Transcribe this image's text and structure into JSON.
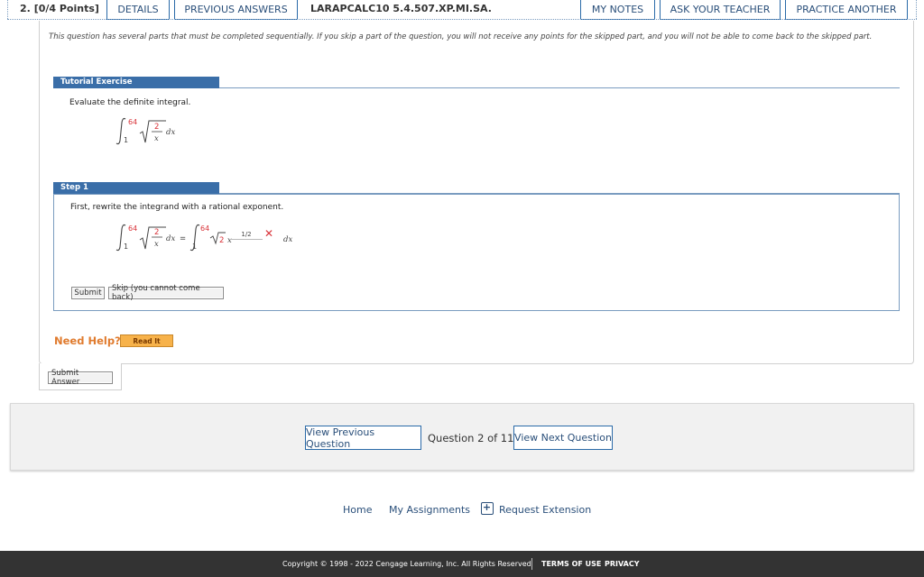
{
  "header": {
    "question_number": "2.",
    "points": "[0/4 Points]",
    "tabs": [
      "DETAILS",
      "PREVIOUS ANSWERS"
    ],
    "question_code": "LARAPCALC10 5.4.507.XP.MI.SA.",
    "actions": [
      "MY NOTES",
      "ASK YOUR TEACHER",
      "PRACTICE ANOTHER"
    ]
  },
  "instructions": "This question has several parts that must be completed sequentially. If you skip a part of the question, you will not receive any points for the skipped part, and you will not be able to come back to the skipped part.",
  "tutorial": {
    "title": "Tutorial Exercise",
    "prompt": "Evaluate the definite integral.",
    "integral": {
      "lower": "1",
      "upper": "64",
      "numerator": "2",
      "denominator": "x",
      "differential": "dx"
    }
  },
  "step1": {
    "title": "Step 1",
    "prompt": "First, rewrite the integrand with a rational exponent.",
    "lhs": {
      "lower": "1",
      "upper": "64",
      "numerator": "2",
      "denominator": "x",
      "differential": "dx",
      "equals": "="
    },
    "rhs": {
      "lower": "1",
      "upper": "64",
      "coef": "2",
      "var": "x",
      "exponent_answer": "1/2",
      "differential": "dx"
    },
    "answer_status": "incorrect",
    "buttons": {
      "submit": "Submit",
      "skip": "Skip (you cannot come back)"
    }
  },
  "help": {
    "label": "Need Help?",
    "read_it": "Read It"
  },
  "submit_answer": "Submit Answer",
  "navigation": {
    "previous": "View Previous Question",
    "position": "Question 2 of 11",
    "next": "View Next Question"
  },
  "links": {
    "home": "Home",
    "assignments": "My Assignments",
    "extension": "Request Extension"
  },
  "footer": {
    "copyright": "Copyright © 1998 - 2022 Cengage Learning, Inc. All Rights Reserved",
    "terms": "TERMS OF USE",
    "privacy": "PRIVACY"
  },
  "colors": {
    "accent": "#3a6ea8",
    "link": "#2a4f7a",
    "help": "#e07b2e",
    "wrong": "#d9343a",
    "footer_bg": "#333333"
  }
}
